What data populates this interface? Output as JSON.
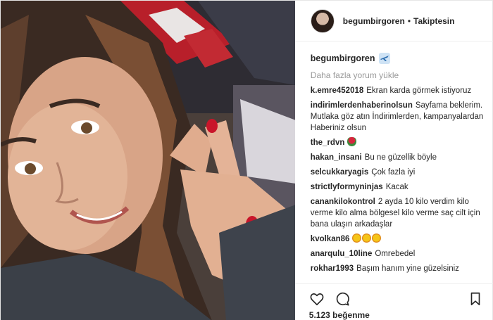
{
  "header": {
    "username": "begumbirgoren",
    "separator": "•",
    "follow_status": "Takiptesin"
  },
  "caption": {
    "username": "begumbirgoren",
    "icon": "airplane-emoji-icon"
  },
  "load_more_label": "Daha fazla yorum yükle",
  "comments": [
    {
      "user": "k.emre452018",
      "text": "Ekran karda görmek istiyoruz"
    },
    {
      "user": "indirimlerdenhaberinolsun",
      "text": "Sayfama beklerim. Mutlaka göz atın İndirimlerden, kampanyalardan Haberiniz olsun"
    },
    {
      "user": "the_rdvn",
      "text": "",
      "emoji": "rose-emoji-icon"
    },
    {
      "user": "hakan_insani",
      "text": "Bu ne güzellik böyle"
    },
    {
      "user": "selcukkaryagis",
      "text": "Çok fazla iyi"
    },
    {
      "user": "strictlyformyninjas",
      "text": "Kacak"
    },
    {
      "user": "canankilokontrol",
      "text": "2 ayda 10 kilo verdim kilo verme kilo alma bölgesel kilo verme saç cilt için bana ulaşın arkadaşlar"
    },
    {
      "user": "kvolkan86",
      "text": "",
      "emoji": "star-eyes-emoji-icon x3"
    },
    {
      "user": "anarqulu_10line",
      "text": "Omrebedel"
    },
    {
      "user": "rokhar1993",
      "text": "Başım hanım yine güzelsiniz"
    }
  ],
  "actions": {
    "like": "heart-icon",
    "comment": "comment-icon",
    "save": "bookmark-icon"
  },
  "likes_label": "5.123 beğenme"
}
